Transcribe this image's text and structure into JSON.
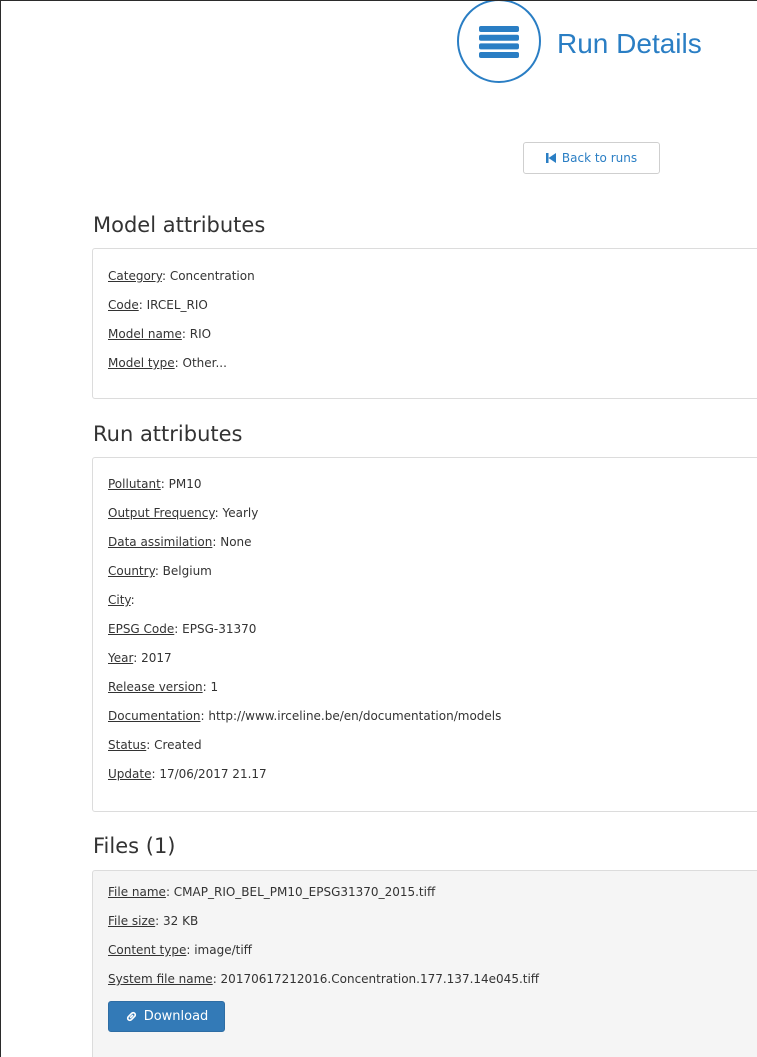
{
  "header": {
    "title": "Run Details",
    "icon": "menu-icon",
    "accent_color": "#2a7ec4"
  },
  "back_button": {
    "label": "Back to runs",
    "icon": "skip-back-icon"
  },
  "model_attributes": {
    "title": "Model attributes",
    "items": [
      {
        "key": "Category",
        "sep": ": ",
        "value": "Concentration"
      },
      {
        "key": "Code",
        "sep": ": ",
        "value": "IRCEL_RIO"
      },
      {
        "key": "Model name",
        "sep": ": ",
        "value": "RIO"
      },
      {
        "key": "Model type",
        "sep": ": ",
        "value": "Other..."
      }
    ]
  },
  "run_attributes": {
    "title": "Run attributes",
    "items": [
      {
        "key": "Pollutant",
        "sep": ": ",
        "value": "PM10"
      },
      {
        "key": "Output Frequency",
        "sep": ": ",
        "value": "Yearly"
      },
      {
        "key": "Data assimilation",
        "sep": ": ",
        "value": "None"
      },
      {
        "key": "Country",
        "sep": ": ",
        "value": "Belgium"
      },
      {
        "key": "City",
        "sep": ":",
        "value": ""
      },
      {
        "key": "EPSG Code",
        "sep": ": ",
        "value": "EPSG-31370"
      },
      {
        "key": "Year",
        "sep": ": ",
        "value": "2017"
      },
      {
        "key": "Release version",
        "sep": ": ",
        "value": "1"
      },
      {
        "key": "Documentation",
        "sep": ": ",
        "value": "http://www.irceline.be/en/documentation/models"
      },
      {
        "key": "Status",
        "sep": ": ",
        "value": "Created"
      },
      {
        "key": "Update",
        "sep": ": ",
        "value": "17/06/2017 21.17"
      }
    ]
  },
  "files": {
    "title": "Files (1)",
    "items": [
      {
        "key": "File name",
        "sep": ": ",
        "value": "CMAP_RIO_BEL_PM10_EPSG31370_2015.tiff"
      },
      {
        "key": "File size",
        "sep": ": ",
        "value": "32 KB"
      },
      {
        "key": "Content type",
        "sep": ": ",
        "value": "image/tiff"
      },
      {
        "key": "System file name",
        "sep": ": ",
        "value": "20170617212016.Concentration.177.137.14e045.tiff"
      }
    ],
    "download_label": "Download",
    "download_icon": "link-icon",
    "download_color": "#337ab7"
  }
}
